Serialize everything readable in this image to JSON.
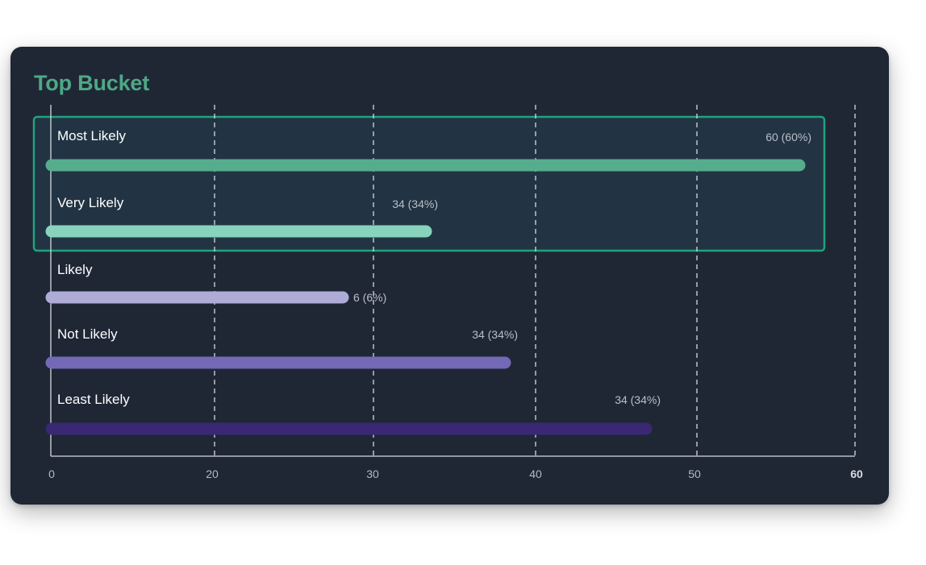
{
  "chart_data": {
    "type": "bar",
    "orientation": "horizontal",
    "title": "Top Bucket",
    "categories": [
      "Most Likely",
      "Very Likely",
      "Likely",
      "Not Likely",
      "Least Likely"
    ],
    "values": [
      60,
      34,
      6,
      34,
      34
    ],
    "value_labels": [
      "60 (60%)",
      "34 (34%)",
      "6 (6%)",
      "34 (34%)",
      "34 (34%)"
    ],
    "bar_colors": [
      "#55ad8c",
      "#88d3bc",
      "#aeabd7",
      "#7369b6",
      "#3a2874"
    ],
    "x_ticks": [
      "0",
      "20",
      "30",
      "40",
      "50",
      "60"
    ],
    "grid": "vertical-dashed",
    "highlight": {
      "categories": [
        "Most Likely",
        "Very Likely"
      ],
      "color": "#1fa27f"
    }
  },
  "colors": {
    "background": "#1f2735",
    "title": "#4ea886",
    "grid": "#d6d9df"
  }
}
